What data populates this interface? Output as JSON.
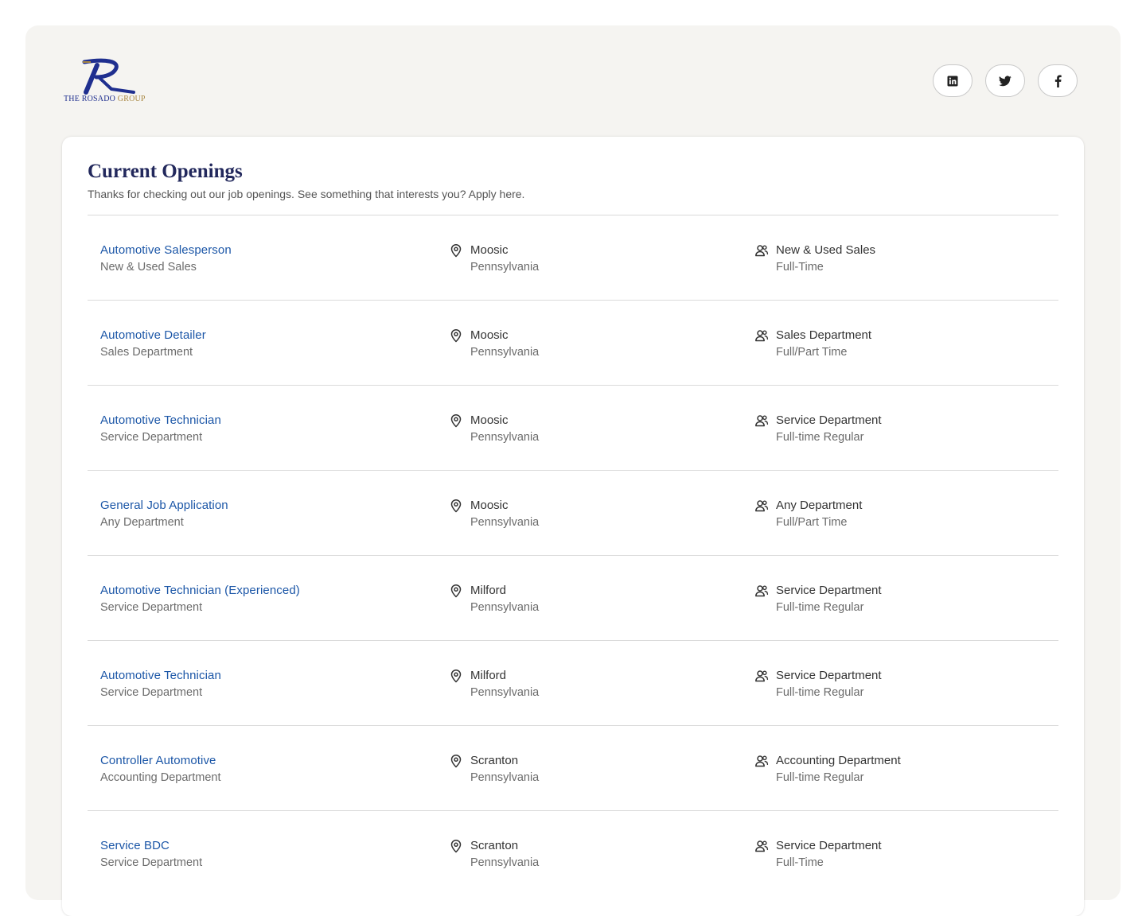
{
  "brand": {
    "logo_text_part1": "THE ",
    "logo_text_part2": "ROSADO",
    "logo_text_part3": " GROUP",
    "colors": {
      "navy": "#1f2f8f",
      "gold": "#a88742"
    }
  },
  "socials": [
    {
      "name": "linkedin",
      "icon": "linkedin-icon"
    },
    {
      "name": "twitter",
      "icon": "twitter-icon"
    },
    {
      "name": "facebook",
      "icon": "facebook-icon"
    }
  ],
  "openings": {
    "title": "Current Openings",
    "subtitle": "Thanks for checking out our job openings. See something that interests you? Apply here.",
    "jobs": [
      {
        "title": "Automotive Salesperson",
        "department": "New & Used Sales",
        "city": "Moosic",
        "state": "Pennsylvania",
        "team": "New & Used Sales",
        "type": "Full-Time"
      },
      {
        "title": "Automotive Detailer",
        "department": "Sales Department",
        "city": "Moosic",
        "state": "Pennsylvania",
        "team": "Sales Department",
        "type": "Full/Part Time"
      },
      {
        "title": "Automotive Technician",
        "department": "Service Department",
        "city": "Moosic",
        "state": "Pennsylvania",
        "team": "Service Department",
        "type": "Full-time Regular"
      },
      {
        "title": "General Job Application",
        "department": "Any Department",
        "city": "Moosic",
        "state": "Pennsylvania",
        "team": "Any Department",
        "type": "Full/Part Time"
      },
      {
        "title": "Automotive Technician (Experienced)",
        "department": "Service Department",
        "city": "Milford",
        "state": "Pennsylvania",
        "team": "Service Department",
        "type": "Full-time Regular"
      },
      {
        "title": "Automotive Technician",
        "department": "Service Department",
        "city": "Milford",
        "state": "Pennsylvania",
        "team": "Service Department",
        "type": "Full-time Regular"
      },
      {
        "title": "Controller Automotive",
        "department": "Accounting Department",
        "city": "Scranton",
        "state": "Pennsylvania",
        "team": "Accounting Department",
        "type": "Full-time Regular"
      },
      {
        "title": "Service BDC",
        "department": "Service Department",
        "city": "Scranton",
        "state": "Pennsylvania",
        "team": "Service Department",
        "type": "Full-Time"
      }
    ]
  },
  "colors": {
    "link": "#1b56a7",
    "title": "#22285c",
    "page_bg": "#f5f4f1"
  }
}
